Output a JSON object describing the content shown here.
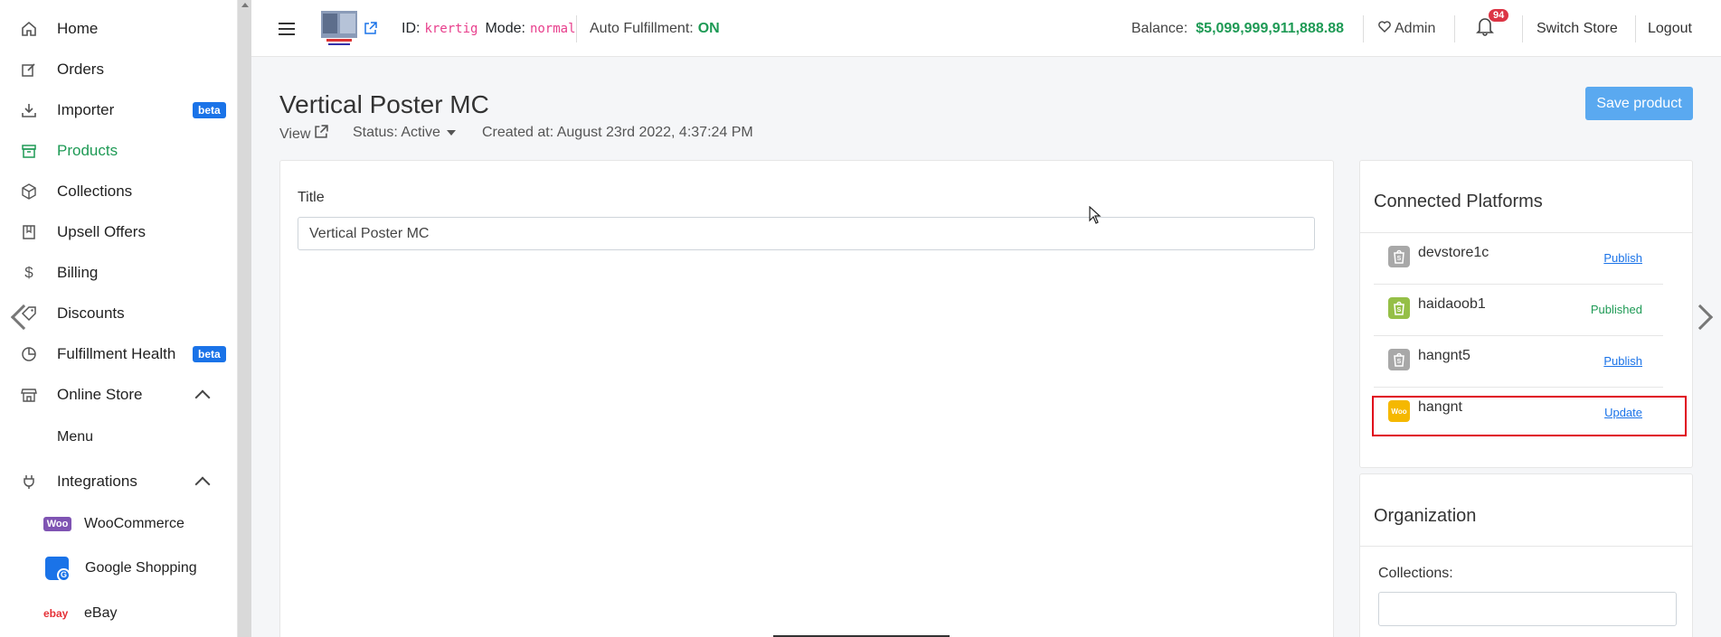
{
  "sidebar": {
    "items": [
      {
        "label": "Home",
        "icon": "home-icon"
      },
      {
        "label": "Orders",
        "icon": "edit-icon"
      },
      {
        "label": "Importer",
        "icon": "download-icon",
        "badge": "beta"
      },
      {
        "label": "Products",
        "icon": "archive-icon",
        "active": true
      },
      {
        "label": "Collections",
        "icon": "box-icon"
      },
      {
        "label": "Upsell Offers",
        "icon": "book-icon"
      },
      {
        "label": "Billing",
        "icon": "dollar-icon"
      },
      {
        "label": "Discounts",
        "icon": "tag-icon"
      },
      {
        "label": "Fulfillment Health",
        "icon": "pie-chart-icon",
        "badge": "beta"
      },
      {
        "label": "Online Store",
        "icon": "store-icon"
      },
      {
        "label": "Integrations",
        "icon": "plug-icon"
      }
    ],
    "online_store_sub": [
      "Menu"
    ],
    "integrations_sub": [
      {
        "label": "WooCommerce",
        "icon": "woocommerce-logo",
        "logo_text": "Woo"
      },
      {
        "label": "Google Shopping",
        "icon": "google-shopping-logo",
        "logo_text": "G"
      },
      {
        "label": "eBay",
        "icon": "ebay-logo",
        "logo_text": "ebay"
      }
    ]
  },
  "topbar": {
    "id_label": "ID:",
    "id_value": "krertig",
    "mode_label": "Mode:",
    "mode_value": "normal",
    "fulfillment_label": "Auto Fulfillment:",
    "fulfillment_value": "ON",
    "balance_label": "Balance:",
    "balance_value": "$5,099,999,911,888.88",
    "admin_label": "Admin",
    "notification_count": "94",
    "switch_store": "Switch Store",
    "logout": "Logout"
  },
  "page": {
    "title": "Vertical Poster MC",
    "view_label": "View",
    "status_label": "Status: Active",
    "created_at": "Created at: August 23rd 2022, 4:37:24 PM",
    "save_button": "Save product"
  },
  "form": {
    "title_label": "Title",
    "title_value": "Vertical Poster MC"
  },
  "platforms": {
    "heading": "Connected Platforms",
    "items": [
      {
        "name": "devstore1c",
        "action": "Publish",
        "status": "unpublished",
        "icon": "shopify-icon"
      },
      {
        "name": "haidaoob1",
        "action": "Published",
        "status": "published",
        "icon": "shopify-icon"
      },
      {
        "name": "hangnt5",
        "action": "Publish",
        "status": "unpublished",
        "icon": "shopify-icon"
      },
      {
        "name": "hangnt",
        "action": "Update",
        "status": "woo",
        "icon": "woocommerce-icon",
        "icon_text": "Woo"
      }
    ]
  },
  "organization": {
    "heading": "Organization",
    "collections_label": "Collections:"
  },
  "colors": {
    "accent_green": "#1e9a55",
    "link_blue": "#1a73e8",
    "highlight_red": "#e0001a",
    "badge_red": "#dc3545"
  }
}
